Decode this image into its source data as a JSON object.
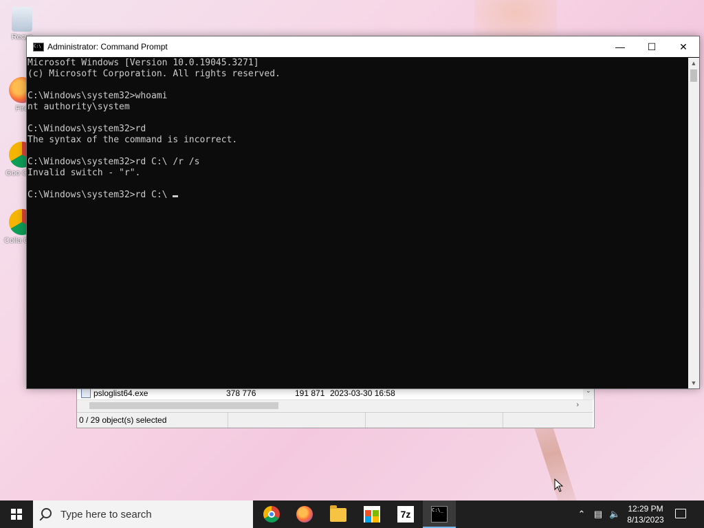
{
  "desktop": {
    "icons": [
      {
        "label": "Recycle Bin",
        "icon": "recycle-bin-icon"
      },
      {
        "label": "Firefox",
        "icon": "firefox-icon"
      },
      {
        "label": "Google Chrome",
        "icon": "chrome-icon"
      },
      {
        "label": "Collab Chrome",
        "icon": "chrome-icon"
      }
    ],
    "icon_labels_visible": [
      "Recyc",
      "Fire",
      "Goo Chro",
      "Colla Chro"
    ]
  },
  "background_window": {
    "file_row": {
      "name": "psloglist64.exe",
      "size": "378 776",
      "packed": "191 871",
      "modified": "2023-03-30 16:58"
    },
    "status_text": "0 / 29 object(s) selected"
  },
  "console_window": {
    "title": "Administrator: Command Prompt",
    "controls": {
      "minimize": "—",
      "maximize": "☐",
      "close": "✕"
    },
    "lines": [
      "Microsoft Windows [Version 10.0.19045.3271]",
      "(c) Microsoft Corporation. All rights reserved.",
      "",
      "C:\\Windows\\system32>whoami",
      "nt authority\\system",
      "",
      "C:\\Windows\\system32>rd",
      "The syntax of the command is incorrect.",
      "",
      "C:\\Windows\\system32>rd C:\\ /r /s",
      "Invalid switch - \"r\".",
      ""
    ],
    "current_input": "C:\\Windows\\system32>rd C:\\ ",
    "colors": {
      "background": "#0c0c0c",
      "text": "#cccccc"
    }
  },
  "taskbar": {
    "search_placeholder": "Type here to search",
    "apps": [
      {
        "name": "Google Chrome",
        "icon": "chrome-icon",
        "active": false
      },
      {
        "name": "Firefox",
        "icon": "firefox-icon",
        "active": false
      },
      {
        "name": "File Explorer",
        "icon": "folder-icon",
        "active": false
      },
      {
        "name": "Microsoft Store",
        "icon": "store-icon",
        "active": false
      },
      {
        "name": "7-Zip",
        "icon": "7zip-icon",
        "label": "7z",
        "active": false
      },
      {
        "name": "Command Prompt",
        "icon": "cmd-icon",
        "active": true
      }
    ],
    "tray": {
      "time": "12:29 PM",
      "date": "8/13/2023"
    },
    "accent": "#76b9ed"
  }
}
